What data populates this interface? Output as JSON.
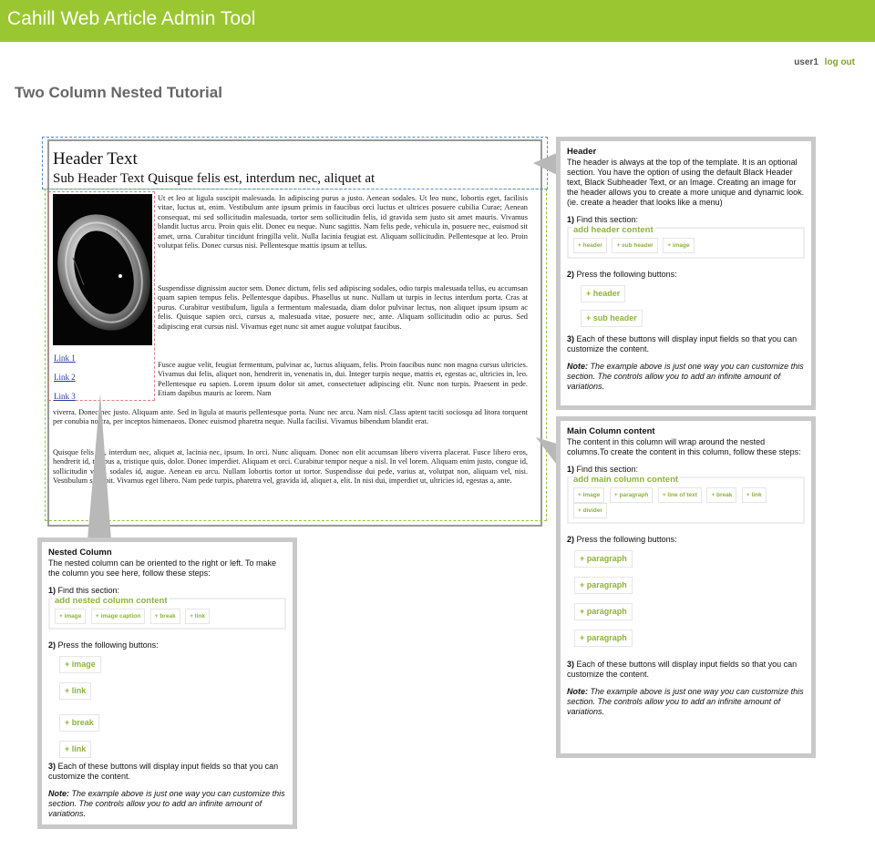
{
  "app": {
    "title": "Cahill Web Article Admin Tool",
    "accent_color": "#9ac731"
  },
  "user": {
    "name": "user1",
    "logout_label": "log out"
  },
  "page": {
    "title": "Two Column Nested Tutorial"
  },
  "article": {
    "header": "Header Text",
    "subheader": "Sub Header Text Quisque felis est, interdum nec, aliquet at",
    "image_alt": "silver engraved ring",
    "links": [
      "Link 1",
      "Link 2",
      "Link 3"
    ],
    "paragraphs": [
      "Ut et leo at ligula suscipit malesuada. In adipiscing purus a justo. Aenean sodales. Ut leo nunc, lobortis eget, facilisis vitae, luctus ut, enim. Vestibulum ante ipsum primis in faucibus orci luctus et ultrices posuere cubilia Curae; Aenean consequat, mi sed sollicitudin malesuada, tortor sem sollicitudin felis, id gravida sem justo sit amet mauris. Vivamus blandit luctus arcu. Proin quis elit. Donec eu neque. Nunc sagittis. Nam felis pede, vehicula in, posuere nec, euismod sit amet, urna. Curabitur tincidunt fringilla velit. Nulla lacinia feugiat est. Aliquam sollicitudin. Pellentesque at leo. Proin volutpat felis. Donec cursus nisi. Pellentesque mattis ipsum at tellus.",
      "Suspendisse dignissim auctor sem. Donec dictum, felis sed adipiscing sodales, odio turpis malesuada tellus, eu accumsan quam sapien tempus felis. Pellentesque dapibus. Phasellus ut nunc. Nullam ut turpis in lectus interdum porta. Cras at purus. Curabitur vestibulum, ligula a fermentum malesuada, diam dolor pulvinar lectus, non aliquet ipsum ipsum ac felis. Quisque sapien orci, cursus a, malesuada vitae, posuere nec, ante. Aliquam sollicitudin odio ac purus. Sed adipiscing erat cursus nisl. Vivamus eget nunc sit amet augue volutpat faucibus.",
      "Fusce augue velit, feugiat fermentum, pulvinar ac, luctus aliquam, felis. Proin faucibus nunc non magna cursus ultricies. Vivamus dui felis, aliquet non, hendrerit in, venenatis in, dui. Integer turpis neque, mattis et, egestas ac, ultricies in, leo. Pellentesque eu sapien. Lorem ipsum dolor sit amet, consectetuer adipiscing elit. Nunc non turpis. Praesent in pede. Etiam dapibus mauris ac lorem. Nam",
      "viverra. Donec nec justo. Aliquam ante. Sed in ligula at mauris pellentesque porta. Nunc nec arcu. Nam nisl. Class aptent taciti sociosqu ad litora torquent per conubia nostra, per inceptos himenaeos. Donec euismod pharetra neque. Nulla facilisi. Vivamus bibendum blandit erat.",
      "Quisque felis est, interdum nec, aliquet at, lacinia nec, ipsum. In orci. Nunc aliquam. Donec non elit accumsan libero viverra placerat. Fusce libero eros, hendrerit id, tempus a, tristique quis, dolor. Donec imperdiet. Aliquam et orci. Curabitur tempor neque a nisl. In vel lorem. Aliquam enim justo, congue id, sollicitudin vitae, sodales id, augue. Aenean eu arcu. Nullam lobortis tortor ut tortor. Suspendisse dui pede, varius at, volutpat non, aliquam vel, nisi. Vestibulum suscipit. Vivamus eget libero. Nam pede turpis, pharetra vel, gravida id, aliquet a, elit. In nisi dui, imperdiet ut, ultricies id, egestas a, ante."
    ]
  },
  "panels": {
    "header": {
      "title": "Header",
      "description": "The header is always at the top of the template. It is an optional section. You have the option of using the default Black Header text, Black Subheader Text, or an Image. Creating an image for the header allows you to create a more unique and dynamic look. (ie. create a header that looks like a menu)",
      "step1_label": "1)",
      "step1_text": "Find this section:",
      "section_title": "add header content",
      "mini_buttons": [
        "+ header",
        "+ sub header",
        "+ image"
      ],
      "step2_label": "2)",
      "step2_text": "Press the following buttons:",
      "buttons": [
        "+ header",
        "+ sub header"
      ],
      "step3_label": "3)",
      "step3_text": "Each of these buttons will display input fields so that you can customize the content.",
      "note_label": "Note:",
      "note_text": "The example above is just one way you can customize this section. The controls allow you to add an infinite amount of variations."
    },
    "main": {
      "title": "Main Column content",
      "description": "The content in this column will wrap around the nested columns.To create the content in this column, follow these steps:",
      "step1_label": "1)",
      "step1_text": "Find this section:",
      "section_title": "add main column content",
      "mini_buttons": [
        "+ image",
        "+ paragraph",
        "+ line of text",
        "+ break",
        "+ link",
        "+ divider"
      ],
      "step2_label": "2)",
      "step2_text": "Press the following buttons:",
      "buttons": [
        "+ paragraph",
        "+ paragraph",
        "+ paragraph",
        "+ paragraph"
      ],
      "step3_label": "3)",
      "step3_text": "Each of these buttons will display input fields so that you can customize the content.",
      "note_label": "Note:",
      "note_text": "The example above is just one way you can customize this section. The controls allow you to add an infinite amount of variations."
    },
    "nested": {
      "title": "Nested Column",
      "description": "The nested column can be oriented to the right or left. To make the column you see here, follow these steps:",
      "step1_label": "1)",
      "step1_text": "Find this section:",
      "section_title": "add nested column content",
      "mini_buttons": [
        "+ image",
        "+ image caption",
        "+ break",
        "+ link"
      ],
      "step2_label": "2)",
      "step2_text": "Press the following buttons:",
      "buttons": [
        "+ image",
        "+ link",
        "+ break",
        "+ link"
      ],
      "step3_label": "3)",
      "step3_text": "Each of these buttons will display input fields so that you can customize the content.",
      "note_label": "Note:",
      "note_text": "The example above is just one way you can customize this section. The controls allow you to add an infinite amount of variations."
    }
  },
  "colors": {
    "header_outline": "#5a8fd0",
    "main_outline": "#8ecb3a",
    "nested_outline": "#d9827e",
    "button_text": "#8db33a",
    "panel_border": "#c9c9c9"
  }
}
